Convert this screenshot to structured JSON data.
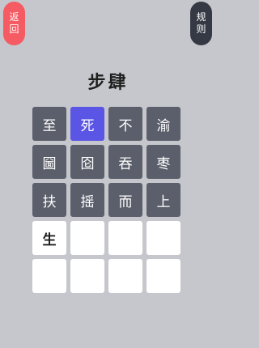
{
  "header": {
    "back_label": "返回",
    "rules_label": "规则"
  },
  "puzzle": {
    "title": "步肆"
  },
  "grid": {
    "tiles": [
      {
        "char": "至",
        "state": "dark"
      },
      {
        "char": "死",
        "state": "selected"
      },
      {
        "char": "不",
        "state": "dark"
      },
      {
        "char": "渝",
        "state": "dark"
      },
      {
        "char": "圙",
        "state": "dark"
      },
      {
        "char": "囵",
        "state": "dark"
      },
      {
        "char": "吞",
        "state": "dark"
      },
      {
        "char": "枣",
        "state": "dark"
      },
      {
        "char": "扶",
        "state": "dark"
      },
      {
        "char": "摇",
        "state": "dark"
      },
      {
        "char": "而",
        "state": "dark"
      },
      {
        "char": "上",
        "state": "dark"
      }
    ],
    "answer_slots": [
      "生",
      "",
      "",
      "",
      "",
      "",
      "",
      ""
    ]
  },
  "colors": {
    "background": "#c6c7cc",
    "tile_dark": "#5b5f6b",
    "tile_selected": "#5b55e6",
    "back_button": "#f45b62",
    "rules_button": "#343944"
  }
}
